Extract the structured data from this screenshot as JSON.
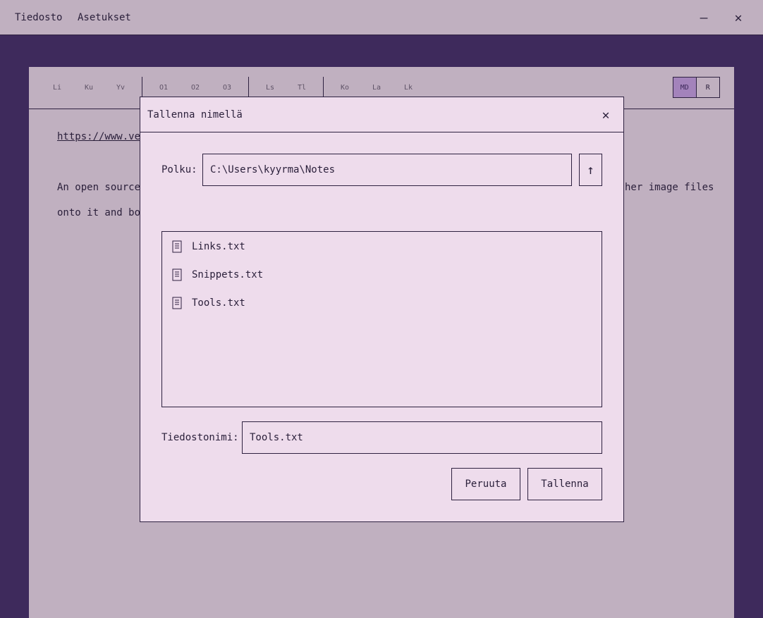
{
  "menu": {
    "file": "Tiedosto",
    "settings": "Asetukset"
  },
  "window": {
    "minimize": "–",
    "close": "✕"
  },
  "toolbar": {
    "groups": [
      [
        "Li",
        "Ku",
        "Yv"
      ],
      [
        "O1",
        "O2",
        "O3"
      ],
      [
        "Ls",
        "Tl"
      ],
      [
        "Ko",
        "La",
        "Lk"
      ]
    ],
    "mode_md": "MD",
    "mode_r": "R"
  },
  "document": {
    "link_partial": "https://www.ver",
    "line1_left": "An open source",
    "line1_right": "her image files",
    "line2_left": "onto it and boo"
  },
  "dialog": {
    "title": "Tallenna nimellä",
    "close": "✕",
    "path_label": "Polku:",
    "path_value": "C:\\Users\\kyyrma\\Notes",
    "up": "↑",
    "files": [
      "Links.txt",
      "Snippets.txt",
      "Tools.txt"
    ],
    "filename_label": "Tiedostonimi:",
    "filename_value": "Tools.txt",
    "cancel": "Peruuta",
    "save": "Tallenna"
  },
  "colors": {
    "background": "#3e2a5c",
    "panel": "#c0b0c0",
    "dialog": "#eedcec",
    "accent": "#a383bb"
  }
}
